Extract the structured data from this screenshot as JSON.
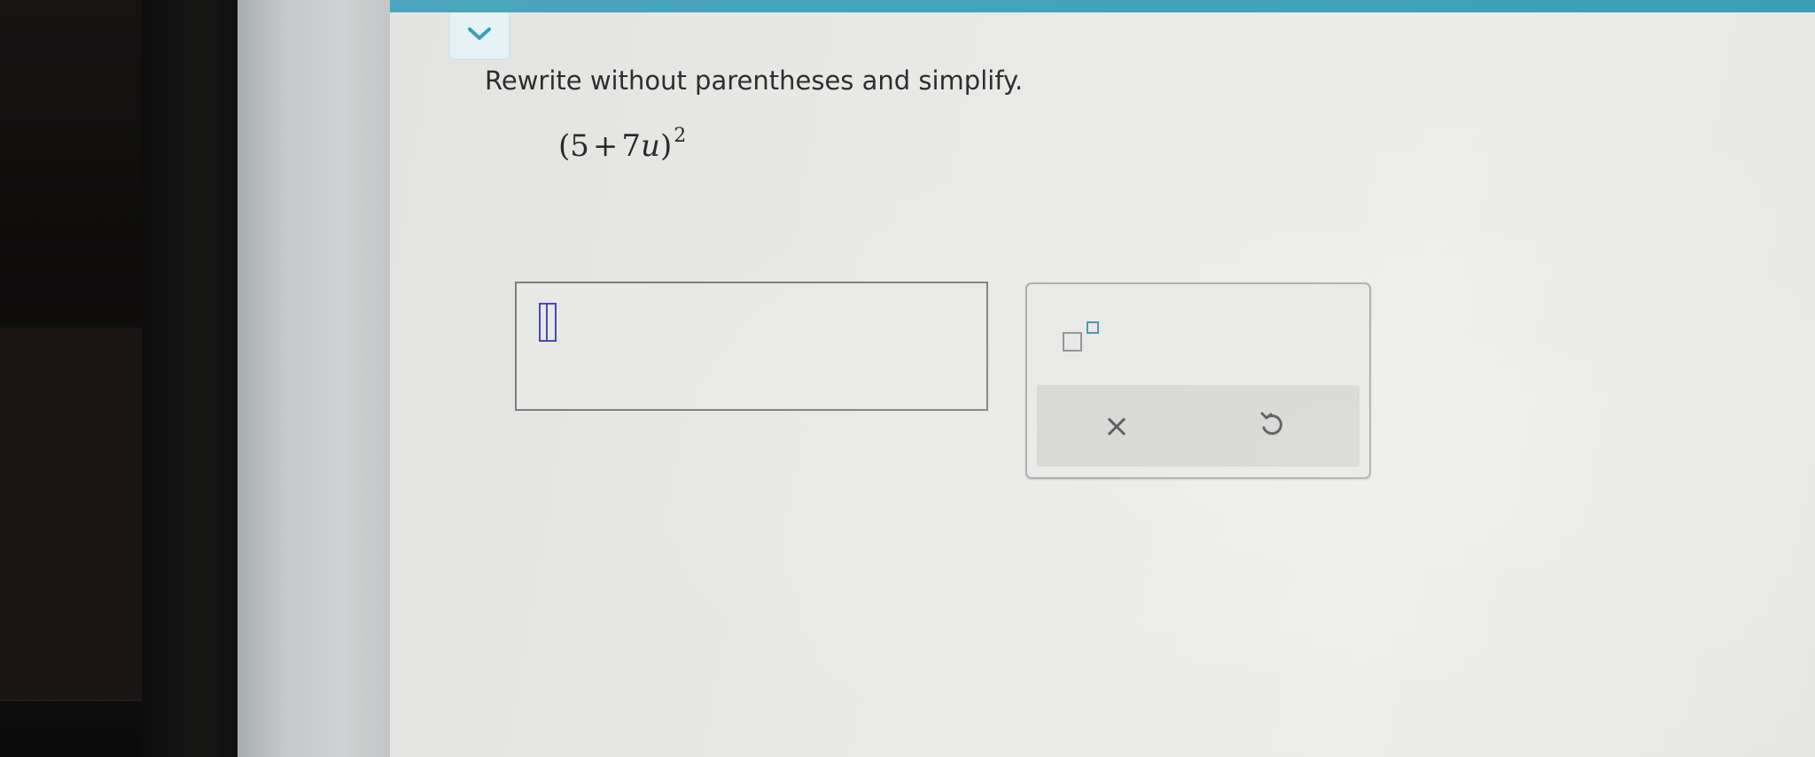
{
  "header": {
    "collapse_icon": "chevron-down-icon",
    "accent_color": "#3b9fb6"
  },
  "problem": {
    "instruction": "Rewrite without parentheses and simplify.",
    "expression": {
      "open": "(",
      "term1": "5",
      "operator": "+",
      "coefficient": "7",
      "variable": "u",
      "close": ")",
      "exponent": "2"
    }
  },
  "answer": {
    "value": "",
    "cursor_color": "#4a47b5"
  },
  "tools": {
    "superscript_icon": "superscript-icon",
    "clear_symbol": "×",
    "undo_icon": "undo-icon"
  }
}
